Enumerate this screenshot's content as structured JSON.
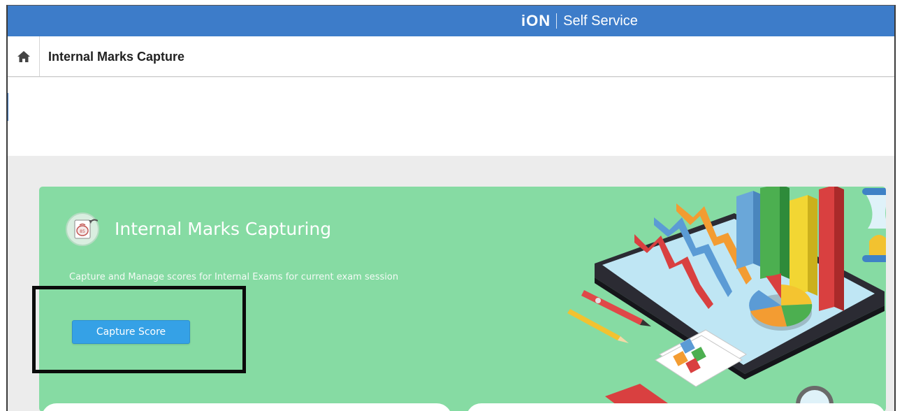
{
  "header": {
    "logo_text": "iON",
    "service_label": "Self Service",
    "bar_color": "#3d7cc9"
  },
  "breadcrumb": {
    "home_icon": "home-icon",
    "title": "Internal Marks Capture"
  },
  "card": {
    "title": "Internal Marks Capturing",
    "description": "Capture and Manage scores for Internal Exams for current exam session",
    "button_label": "Capture Score",
    "background_color": "#86dba3",
    "button_color": "#35a1e6",
    "icon": "marks-bag-icon",
    "illustration": "tablet-analytics-illustration"
  }
}
